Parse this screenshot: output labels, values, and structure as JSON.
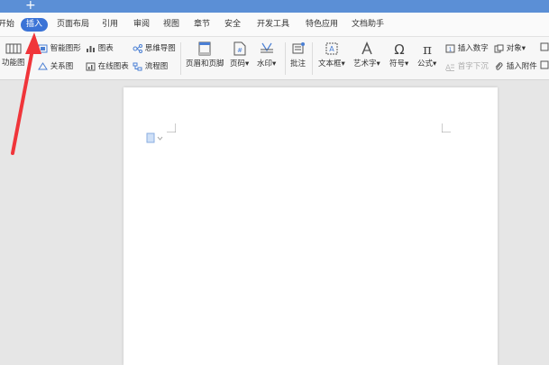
{
  "titlebar": {
    "new_tab_glyph": "+"
  },
  "menu": {
    "items": [
      "开始",
      "插入",
      "页面布局",
      "引用",
      "审阅",
      "视图",
      "章节",
      "安全",
      "开发工具",
      "特色应用",
      "文档助手"
    ],
    "active": "插入"
  },
  "ribbon": {
    "function_chart": "功能图",
    "smart_shape": "智能图形",
    "chart": "图表",
    "mind_map": "思维导图",
    "relation_chart": "关系图",
    "online_chart": "在线图表",
    "flowchart": "流程图",
    "header_footer": "页眉和页脚",
    "page_number": "页码",
    "watermark": "水印",
    "comment": "批注",
    "textbox": "文本框",
    "art_text": "艺术字",
    "symbol": "符号",
    "formula": "公式",
    "insert_number": "插入数字",
    "object": "对象",
    "drop_cap": "首字下沉",
    "insert_attachment": "插入附件",
    "dropdown_glyph": "▾"
  },
  "colors": {
    "accent": "#3b73d6",
    "titlebar": "#5b8fd6",
    "arrow": "#f0353a"
  }
}
